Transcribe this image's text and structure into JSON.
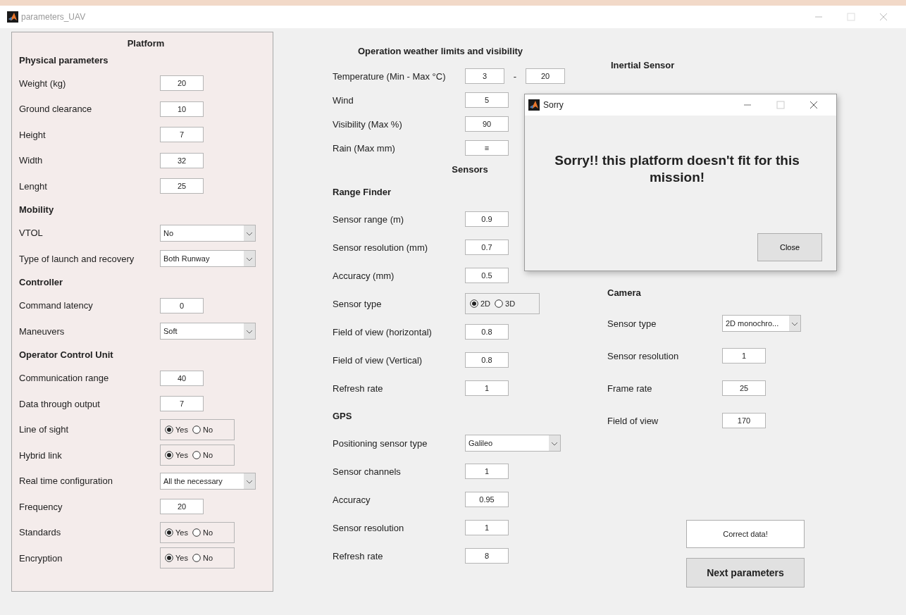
{
  "window": {
    "title": "parameters_UAV"
  },
  "platform": {
    "title": "Platform",
    "items": [
      {
        "kind": "heading",
        "label": "Physical parameters"
      },
      {
        "kind": "field",
        "label": "Weight (kg)",
        "value": "20"
      },
      {
        "kind": "field",
        "label": "Ground clearance",
        "value": "10"
      },
      {
        "kind": "field",
        "label": "Height",
        "value": "7"
      },
      {
        "kind": "field",
        "label": "Width",
        "value": "32"
      },
      {
        "kind": "field",
        "label": "Lenght",
        "value": "25"
      },
      {
        "kind": "heading",
        "label": "Mobility"
      },
      {
        "kind": "dropdown",
        "label": "VTOL",
        "value": "No"
      },
      {
        "kind": "dropdown",
        "label": "Type of launch and recovery",
        "value": "Both Runway"
      },
      {
        "kind": "heading",
        "label": "Controller"
      },
      {
        "kind": "field",
        "label": "Command latency",
        "value": "0"
      },
      {
        "kind": "dropdown",
        "label": "Maneuvers",
        "value": "Soft"
      },
      {
        "kind": "heading",
        "label": "Operator Control Unit"
      },
      {
        "kind": "field",
        "label": "Communication range",
        "value": "40"
      },
      {
        "kind": "field",
        "label": "Data through output",
        "value": "7"
      },
      {
        "kind": "radio",
        "label": "Line of sight",
        "options": [
          {
            "label": "Yes",
            "selected": true
          },
          {
            "label": "No",
            "selected": false
          }
        ]
      },
      {
        "kind": "radio",
        "label": "Hybrid link",
        "options": [
          {
            "label": "Yes",
            "selected": true
          },
          {
            "label": "No",
            "selected": false
          }
        ]
      },
      {
        "kind": "dropdown",
        "label": "Real time configuration",
        "value": "All the necessary"
      },
      {
        "kind": "field",
        "label": "Frequency",
        "value": "20"
      },
      {
        "kind": "radio",
        "label": "Standards",
        "options": [
          {
            "label": "Yes",
            "selected": true
          },
          {
            "label": "No",
            "selected": false
          }
        ]
      },
      {
        "kind": "radio",
        "label": "Encryption",
        "options": [
          {
            "label": "Yes",
            "selected": true
          },
          {
            "label": "No",
            "selected": false
          }
        ]
      }
    ]
  },
  "weather": {
    "title": "Operation weather limits and visibility",
    "items": [
      {
        "kind": "range",
        "label": "Temperature (Min - Max °C)",
        "min": "3",
        "separator": "-",
        "max": "20"
      },
      {
        "kind": "field",
        "label": "Wind",
        "value": "5"
      },
      {
        "kind": "field",
        "label": "Visibility (Max %)",
        "value": "90"
      },
      {
        "kind": "field",
        "label": "Rain (Max mm)",
        "value": "≡"
      }
    ]
  },
  "sensors": {
    "title": "Sensors",
    "items": [
      {
        "kind": "heading",
        "label": "Range Finder"
      },
      {
        "kind": "field",
        "label": "Sensor range (m)",
        "value": "0.9"
      },
      {
        "kind": "field",
        "label": "Sensor resolution (mm)",
        "value": "0.7"
      },
      {
        "kind": "field",
        "label": "Accuracy (mm)",
        "value": "0.5"
      },
      {
        "kind": "radio",
        "label": "Sensor type",
        "options": [
          {
            "label": "2D",
            "selected": true
          },
          {
            "label": "3D",
            "selected": false
          }
        ]
      },
      {
        "kind": "field",
        "label": "Field of view (horizontal)",
        "value": "0.8"
      },
      {
        "kind": "field",
        "label": "Field of view (Vertical)",
        "value": "0.8"
      },
      {
        "kind": "field",
        "label": "Refresh rate",
        "value": "1"
      },
      {
        "kind": "heading",
        "label": "GPS"
      },
      {
        "kind": "dropdown",
        "label": "Positioning sensor type",
        "value": "Galileo"
      },
      {
        "kind": "field",
        "label": "Sensor channels",
        "value": "1"
      },
      {
        "kind": "field",
        "label": "Accuracy",
        "value": "0.95"
      },
      {
        "kind": "field",
        "label": "Sensor resolution",
        "value": "1"
      },
      {
        "kind": "field",
        "label": "Refresh rate",
        "value": "8"
      }
    ]
  },
  "inertial": {
    "title": "Inertial Sensor"
  },
  "camera": {
    "title": "Camera",
    "items": [
      {
        "kind": "dropdown",
        "label": "Sensor type",
        "value": "2D monochro..."
      },
      {
        "kind": "field",
        "label": "Sensor resolution",
        "value": "1"
      },
      {
        "kind": "field",
        "label": "Frame rate",
        "value": "25"
      },
      {
        "kind": "field",
        "label": "Field of view",
        "value": "170"
      }
    ]
  },
  "buttons": [
    {
      "kind": "plain",
      "label": "Correct data!"
    },
    {
      "kind": "primary",
      "label": "Next parameters"
    }
  ],
  "dialog": {
    "title": "Sorry",
    "message": "Sorry!! this platform doesn't fit for this mission!",
    "button": "Close"
  }
}
